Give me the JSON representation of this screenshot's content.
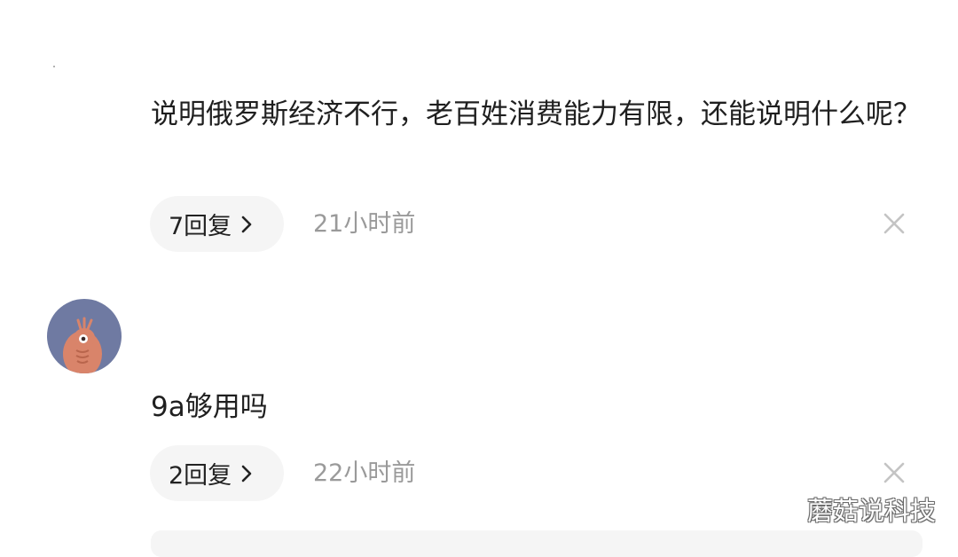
{
  "comments": [
    {
      "text": "说明俄罗斯经济不行，老百姓消费能力有限，还能说明什么呢？",
      "reply_label": "7回复",
      "time": "21小时前"
    },
    {
      "text": "9a够用吗",
      "reply_label": "2回复",
      "time": "22小时前"
    }
  ],
  "icons": {
    "chevron": "chevron-right-icon",
    "close": "close-icon",
    "avatar": "avatar"
  },
  "colors": {
    "avatar_bg": "#6f7aa2",
    "avatar_figure": "#d9846a",
    "pill_bg": "#f5f5f5",
    "muted_text": "#9a9a9a",
    "close_icon": "#c4c4c4"
  },
  "watermark": "蘑菇说科技"
}
